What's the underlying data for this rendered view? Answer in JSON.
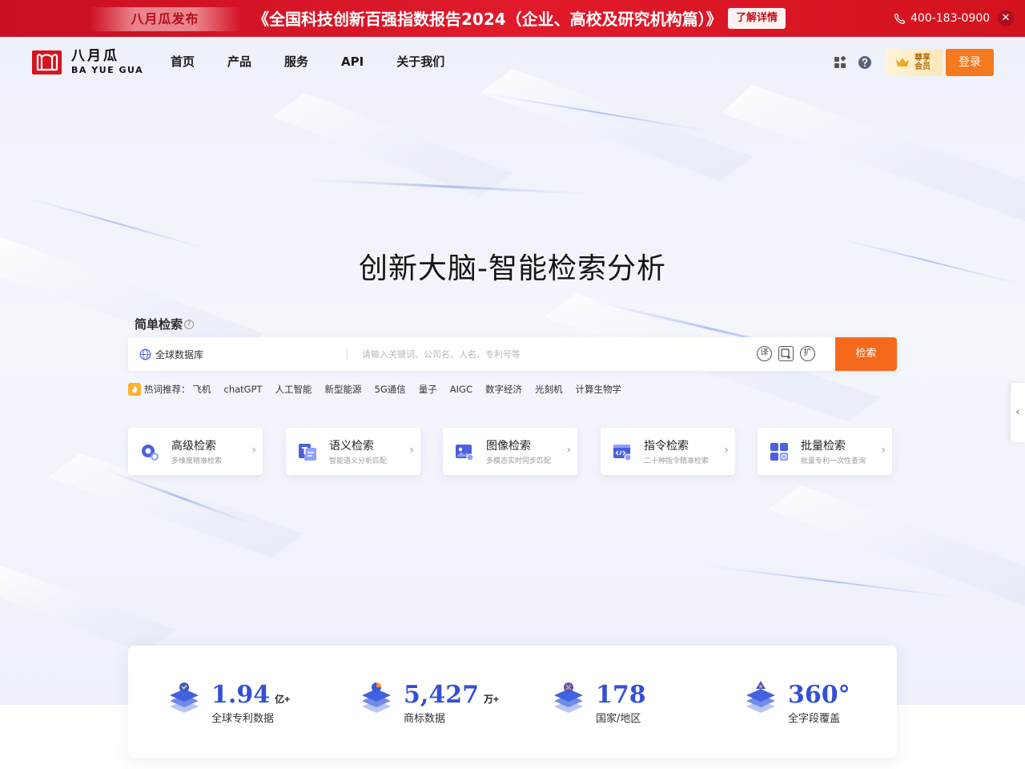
{
  "promo": {
    "tag": "八月瓜发布",
    "title": "《全国科技创新百强指数报告2024（企业、高校及研究机构篇）》",
    "button": "了解详情",
    "phone": "400-183-0900",
    "close": "✕"
  },
  "logo": {
    "cn": "八月瓜",
    "en": "BA YUE GUA"
  },
  "nav": {
    "items": [
      "首页",
      "产品",
      "服务",
      "API",
      "关于我们"
    ]
  },
  "header_right": {
    "vip_line1": "尊享",
    "vip_line2": "会员",
    "login": "登录"
  },
  "hero": {
    "title": "创新大脑-智能检索分析"
  },
  "search": {
    "label": "简单检索",
    "help": "?",
    "database": "全球数据库",
    "placeholder": "请输入关键词、公司名、人名、专利号等",
    "tools": [
      "译",
      "",
      "扩"
    ],
    "button": "检索"
  },
  "hot": {
    "label": "热词推荐：",
    "items": [
      "飞机",
      "chatGPT",
      "人工智能",
      "新型能源",
      "5G通信",
      "量子",
      "AIGC",
      "数字经济",
      "光刻机",
      "计算生物学"
    ]
  },
  "cards": [
    {
      "title": "高级检索",
      "sub": "多维度精准检索",
      "icon": "gear-search-icon"
    },
    {
      "title": "语义检索",
      "sub": "智能语义分析匹配",
      "icon": "text-document-icon"
    },
    {
      "title": "图像检索",
      "sub": "多模态实时同步匹配",
      "icon": "image-search-icon"
    },
    {
      "title": "指令检索",
      "sub": "二十种指令精准检索",
      "icon": "code-command-icon"
    },
    {
      "title": "批量检索",
      "sub": "批量专利一次性查询",
      "icon": "grid-batch-icon"
    }
  ],
  "stats": [
    {
      "num": "1.94",
      "unit": "亿+",
      "label": "全球专利数据",
      "icon": "patent-stack-icon"
    },
    {
      "num": "5,427",
      "unit": "万+",
      "label": "商标数据",
      "icon": "trademark-stack-icon"
    },
    {
      "num": "178",
      "unit": "",
      "label": "国家/地区",
      "icon": "globe-stack-icon"
    },
    {
      "num": "360°",
      "unit": "",
      "label": "全字段覆盖",
      "icon": "coverage-stack-icon"
    }
  ],
  "colors": {
    "brand_red": "#d7141d",
    "accent_orange": "#f5691c",
    "stat_blue": "#3450d7"
  }
}
